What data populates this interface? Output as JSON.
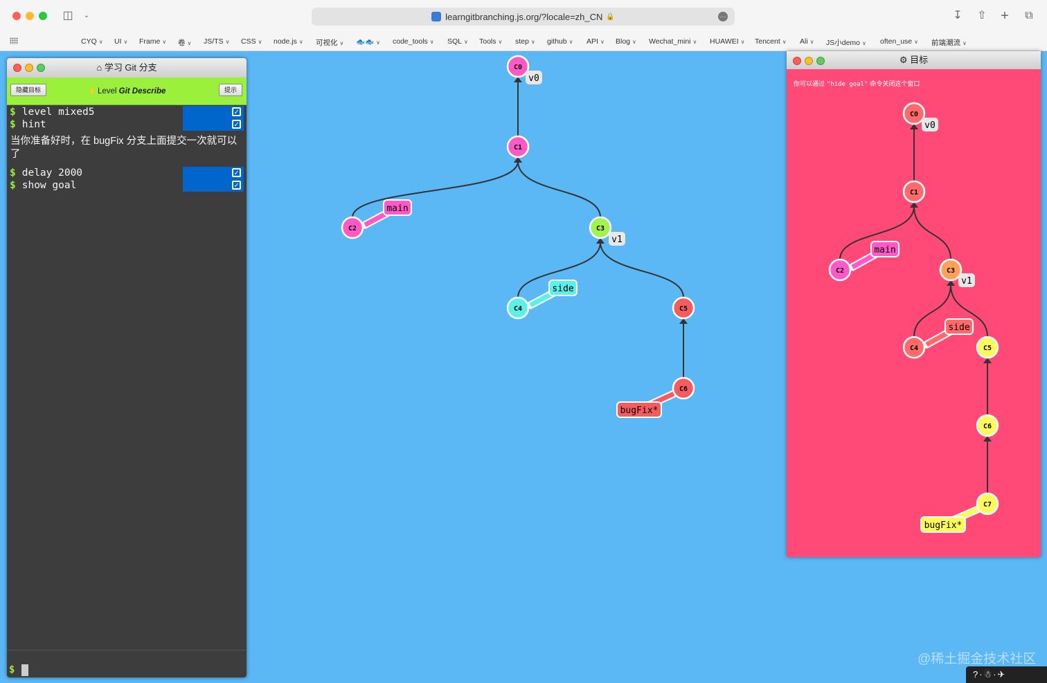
{
  "browser": {
    "url": "learngitbranching.js.org/?locale=zh_CN",
    "bookmarks": [
      "CYQ",
      "UI",
      "Frame",
      "卷",
      "JS/TS",
      "CSS",
      "node.js",
      "可视化",
      "🐟🐟",
      "code_tools",
      "SQL",
      "Tools",
      "step",
      "github",
      "API",
      "Blog",
      "Wechat_mini",
      "HUAWEI",
      "Tencent",
      "Ali",
      "JS小demo",
      "often_use",
      "前端潮流"
    ]
  },
  "terminal": {
    "title": "学习 Git 分支",
    "hide_goal_button": "隐藏目标",
    "hint_button": "提示",
    "level_prefix": "Level",
    "level_name": "Git Describe",
    "dollar": "$",
    "commands_top": [
      "level mixed5",
      "hint"
    ],
    "message": "当你准备好时，在 bugFix 分支上面提交一次就可以了",
    "commands_bottom": [
      "delay 2000",
      "show goal"
    ]
  },
  "main_tree": {
    "commits": [
      {
        "id": "C0",
        "color": "#ff59c7"
      },
      {
        "id": "C1",
        "color": "#ff59c7"
      },
      {
        "id": "C2",
        "color": "#ff59c7"
      },
      {
        "id": "C3",
        "color": "#a2f251"
      },
      {
        "id": "C4",
        "color": "#5cf0e8"
      },
      {
        "id": "C5",
        "color": "#f55c60"
      },
      {
        "id": "C6",
        "color": "#f55c60"
      }
    ],
    "branches": [
      {
        "name": "main",
        "color": "#ff59c7"
      },
      {
        "name": "side",
        "color": "#5cf0e8"
      },
      {
        "name": "bugFix*",
        "color": "#f55c60"
      }
    ],
    "tags": [
      "v0",
      "v1"
    ]
  },
  "goal": {
    "title": "目标",
    "hint_prefix": "你可以通过 ",
    "hint_code": "\"hide goal\"",
    "hint_suffix": " 命令关闭这个窗口",
    "commits": [
      {
        "id": "C0",
        "color": "#ff6a6a"
      },
      {
        "id": "C1",
        "color": "#ff6a6a"
      },
      {
        "id": "C2",
        "color": "#ff59c7"
      },
      {
        "id": "C3",
        "color": "#ffa15a"
      },
      {
        "id": "C4",
        "color": "#ff6a6a"
      },
      {
        "id": "C5",
        "color": "#fffa5c"
      },
      {
        "id": "C6",
        "color": "#fffa5c"
      },
      {
        "id": "C7",
        "color": "#fffa5c"
      }
    ],
    "branches": [
      {
        "name": "main",
        "color": "#ff59c7"
      },
      {
        "name": "side",
        "color": "#ff6a6a"
      },
      {
        "name": "bugFix*",
        "color": "#fffa5c"
      }
    ],
    "tags": [
      "v0",
      "v1"
    ]
  },
  "watermark": "@稀土掘金技术社区",
  "bottom_bar": "?·☃·✈"
}
